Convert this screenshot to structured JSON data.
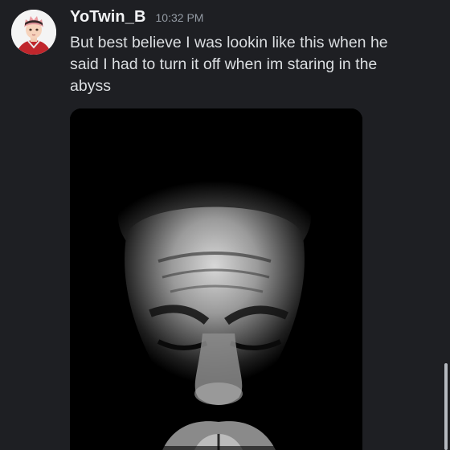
{
  "message": {
    "username": "YoTwin_B",
    "timestamp": "10:32 PM",
    "lines": [
      "But best believe I was lookin like this when he",
      "said I had to turn it off when im staring in the",
      "abyss"
    ]
  },
  "avatar": {
    "icon": "user-avatar-icon"
  },
  "attachment": {
    "icon": "image-attachment"
  },
  "colors": {
    "background": "#1e1f23",
    "username": "#f2f3f5",
    "timestamp": "#949ba4",
    "text": "#dbdee1"
  }
}
